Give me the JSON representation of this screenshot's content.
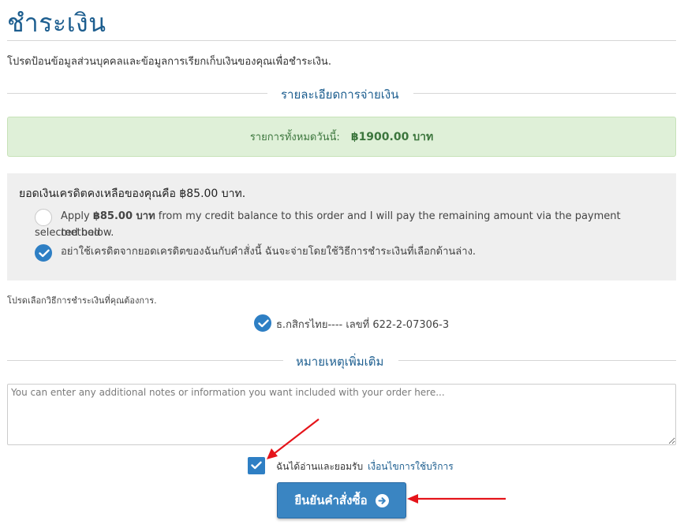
{
  "page": {
    "title": "ชำระเงิน",
    "intro": "โปรดป้อนข้อมูลส่วนบุคคลและข้อมูลการเรียกเก็บเงินของคุณเพื่อชำระเงิน."
  },
  "payment_details": {
    "heading": "รายละเอียดการจ่ายเงิน",
    "total_label": "รายการทั้งหมดวันนี้:",
    "total_amount": "฿1900.00 บาท"
  },
  "credit": {
    "heading": "ยอดเงินเครดิตคงเหลือของคุณคือ ฿85.00 บาท.",
    "option_apply_prefix": "Apply",
    "option_apply_amount": "฿85.00 บาท",
    "option_apply_rest": "from my credit balance to this order and I will pay the remaining amount via the payment method",
    "option_apply_line2": "selected below.",
    "option_no_credit": "อย่าใช้เครดิตจากยอดเครดิตของฉันกับคำสั่งนี้ ฉันจะจ่ายโดยใช้วิธีการชำระเงินที่เลือกด้านล่าง.",
    "selected_option": "no_credit"
  },
  "payment_method": {
    "prompt": "โปรดเลือกวิธีการชำระเงินที่คุณต้องการ.",
    "option_label": "ธ.กสิกรไทย---- เลขที่ 622-2-07306-3"
  },
  "notes": {
    "heading": "หมายเหตุเพิ่มเติม",
    "placeholder": "You can enter any additional notes or information you want included with your order here..."
  },
  "tos": {
    "text": "ฉันได้อ่านและยอมรับ",
    "link": "เงื่อนไขการใช้บริการ",
    "checked": true
  },
  "submit": {
    "label": "ยืนยันคำสั่งซื้อ"
  },
  "colors": {
    "heading_blue": "#1d5e8f",
    "accent_blue": "#2e7fc4",
    "success_bg": "#dff0d8",
    "success_text": "#3c763d",
    "arrow_red": "#e5141a"
  }
}
